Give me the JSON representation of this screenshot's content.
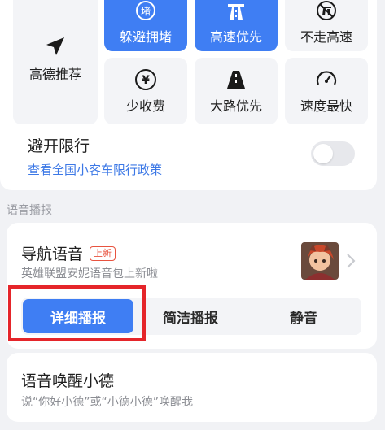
{
  "route_prefs": {
    "recommend": {
      "label": "高德推荐",
      "icon": "paper-plane-icon"
    },
    "options": [
      {
        "label": "躲避拥堵",
        "icon": "congestion-icon",
        "active": true
      },
      {
        "label": "高速优先",
        "icon": "highway-icon",
        "active": true
      },
      {
        "label": "不走高速",
        "icon": "no-highway-icon",
        "active": false
      },
      {
        "label": "少收费",
        "icon": "yuan-icon",
        "active": false
      },
      {
        "label": "大路优先",
        "icon": "road-icon",
        "active": false
      },
      {
        "label": "速度最快",
        "icon": "speedometer-icon",
        "active": false
      }
    ],
    "congestion_glyph": "堵",
    "yuan_glyph": "¥"
  },
  "avoid_restriction": {
    "title": "避开限行",
    "link": "查看全国小客车限行政策",
    "enabled": false
  },
  "voice_section": {
    "label": "语音播报",
    "nav_voice": {
      "title": "导航语音",
      "badge": "上新",
      "subtitle": "英雄联盟安妮语音包上新啦"
    },
    "modes": [
      "详细播报",
      "简洁播报",
      "静音"
    ],
    "selected_mode": "详细播报"
  },
  "wake": {
    "title": "语音唤醒小德",
    "subtitle": "说“你好小德”或“小德小德”唤醒我"
  },
  "colors": {
    "accent": "#3f7ef3",
    "link": "#3c78e6",
    "badge": "#e8533f",
    "highlight": "#e5252a"
  }
}
